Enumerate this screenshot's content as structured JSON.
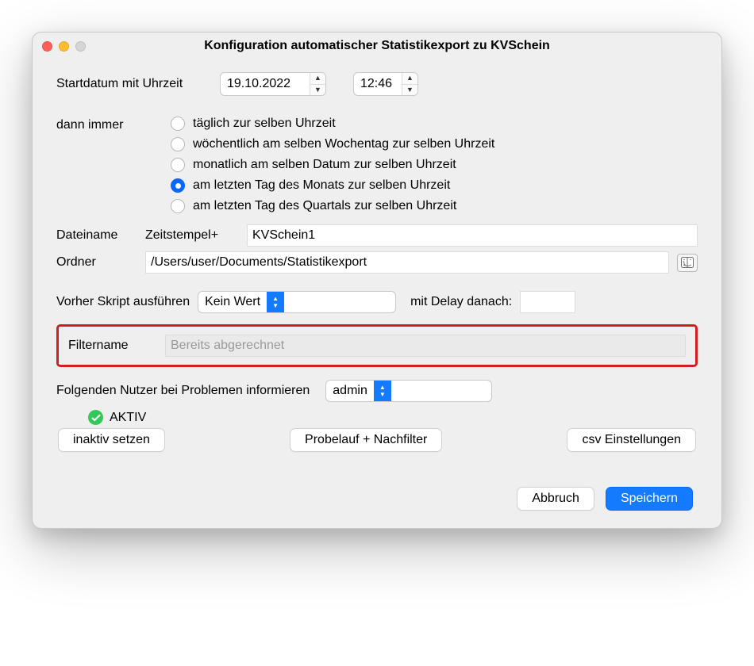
{
  "window": {
    "title": "Konfiguration automatischer Statistikexport zu KVSchein"
  },
  "startdate": {
    "label": "Startdatum mit Uhrzeit",
    "date_value": "19.10.2022",
    "time_value": "12:46"
  },
  "recurrence": {
    "label": "dann immer",
    "options": [
      {
        "label": "täglich zur selben Uhrzeit",
        "selected": false
      },
      {
        "label": "wöchentlich am selben Wochentag zur selben Uhrzeit",
        "selected": false
      },
      {
        "label": "monatlich am selben Datum zur selben Uhrzeit",
        "selected": false
      },
      {
        "label": "am letzten Tag des Monats zur selben Uhrzeit",
        "selected": true
      },
      {
        "label": "am letzten Tag des Quartals zur selben Uhrzeit",
        "selected": false
      }
    ]
  },
  "filename": {
    "label": "Dateiname",
    "prefix_label": "Zeitstempel+",
    "value": "KVSchein1"
  },
  "folder": {
    "label": "Ordner",
    "value": "/Users/user/Documents/Statistikexport"
  },
  "script": {
    "label": "Vorher Skript ausführen",
    "selected": "Kein Wert",
    "delay_label": "mit Delay danach:",
    "delay_value": ""
  },
  "filter": {
    "label": "Filtername",
    "placeholder": "Bereits abgerechnet"
  },
  "inform": {
    "label": "Folgenden Nutzer bei Problemen informieren",
    "selected": "admin"
  },
  "status": {
    "text": "AKTIV"
  },
  "buttons": {
    "deactivate": "inaktiv setzen",
    "testrun": "Probelauf + Nachfilter",
    "csv_settings": "csv Einstellungen",
    "cancel": "Abbruch",
    "save": "Speichern"
  }
}
